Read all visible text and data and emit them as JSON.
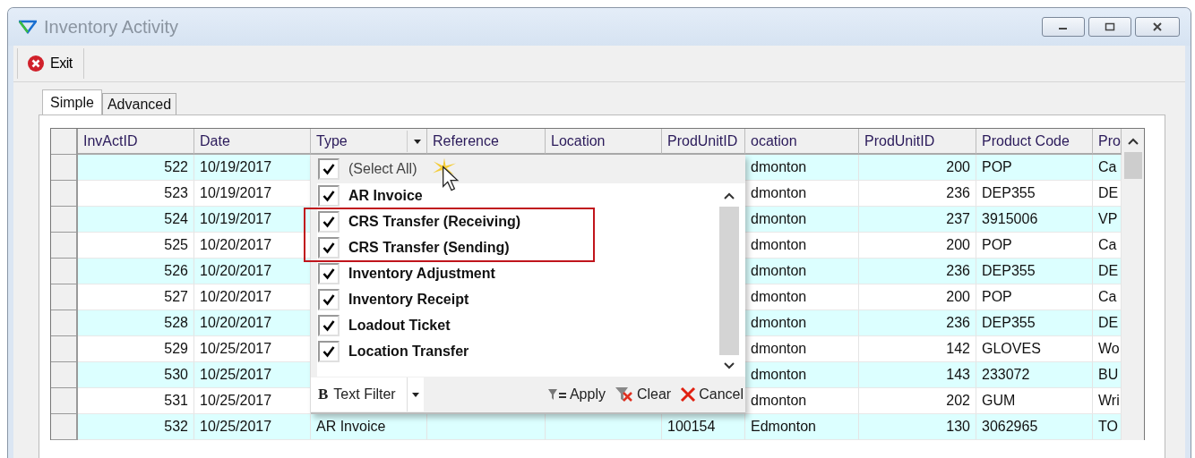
{
  "window": {
    "title": "Inventory Activity"
  },
  "toolbar": [
    {
      "label": "Exit"
    }
  ],
  "tabs": [
    {
      "label": "Simple",
      "selected": true
    },
    {
      "label": "Advanced",
      "selected": false
    }
  ],
  "grid": {
    "columns": [
      "InvActID",
      "Date",
      "Type",
      "Reference",
      "Location",
      "ProdUnitID",
      "ocation",
      "ProdUnitID",
      "Product Code",
      "Pro"
    ],
    "rows": [
      {
        "cells": [
          "522",
          "10/19/2017",
          null,
          null,
          null,
          null,
          "dmonton",
          "200",
          "POP",
          "Ca"
        ]
      },
      {
        "cells": [
          "523",
          "10/19/2017",
          null,
          null,
          null,
          null,
          "dmonton",
          "236",
          "DEP355",
          "DE"
        ]
      },
      {
        "cells": [
          "524",
          "10/19/2017",
          null,
          null,
          null,
          null,
          "dmonton",
          "237",
          "3915006",
          "VP"
        ]
      },
      {
        "cells": [
          "525",
          "10/20/2017",
          null,
          null,
          null,
          null,
          "dmonton",
          "200",
          "POP",
          "Ca"
        ]
      },
      {
        "cells": [
          "526",
          "10/20/2017",
          null,
          null,
          null,
          null,
          "dmonton",
          "236",
          "DEP355",
          "DE"
        ]
      },
      {
        "cells": [
          "527",
          "10/20/2017",
          null,
          null,
          null,
          null,
          "dmonton",
          "200",
          "POP",
          "Ca"
        ]
      },
      {
        "cells": [
          "528",
          "10/20/2017",
          null,
          null,
          null,
          null,
          "dmonton",
          "236",
          "DEP355",
          "DE"
        ]
      },
      {
        "cells": [
          "529",
          "10/25/2017",
          null,
          null,
          null,
          null,
          "dmonton",
          "142",
          "GLOVES",
          "Wo"
        ]
      },
      {
        "cells": [
          "530",
          "10/25/2017",
          null,
          null,
          null,
          null,
          "dmonton",
          "143",
          "233072",
          "BU"
        ]
      },
      {
        "cells": [
          "531",
          "10/25/2017",
          null,
          null,
          null,
          null,
          "dmonton",
          "202",
          "GUM",
          "Wri"
        ]
      },
      {
        "cells": [
          "532",
          "10/25/2017",
          "AR Invoice",
          null,
          null,
          "100154",
          "Edmonton",
          "130",
          "3062965",
          "TO"
        ]
      }
    ]
  },
  "filter_popup": {
    "select_all": {
      "label": "(Select All)",
      "checked": true
    },
    "items": [
      {
        "label": "AR Invoice",
        "checked": true,
        "highlighted": false
      },
      {
        "label": "CRS Transfer (Receiving)",
        "checked": true,
        "highlighted": true
      },
      {
        "label": "CRS Transfer (Sending)",
        "checked": true,
        "highlighted": true
      },
      {
        "label": "Inventory Adjustment",
        "checked": true,
        "highlighted": false
      },
      {
        "label": "Inventory Receipt",
        "checked": true,
        "highlighted": false
      },
      {
        "label": "Loadout Ticket",
        "checked": true,
        "highlighted": false
      },
      {
        "label": "Location Transfer",
        "checked": true,
        "highlighted": false
      }
    ],
    "text_filter": {
      "icon": "B",
      "label": "Text Filter"
    },
    "buttons": [
      {
        "kind": "apply",
        "label": "Apply"
      },
      {
        "kind": "clear",
        "label": "Clear"
      },
      {
        "kind": "cancel",
        "label": "Cancel"
      }
    ]
  }
}
